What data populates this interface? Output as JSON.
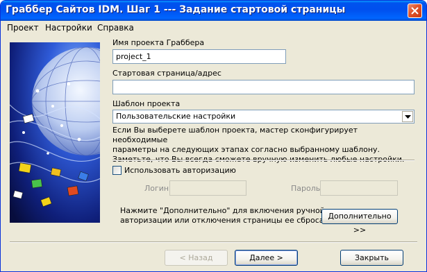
{
  "window": {
    "title": "Граббер Сайтов IDM. Шаг 1 --- Задание стартовой страницы"
  },
  "menu": {
    "items": [
      "Проект",
      "Настройки",
      "Справка"
    ]
  },
  "form": {
    "project_name_label": "Имя проекта Граббера",
    "project_name_value": "project_1",
    "start_page_label": "Стартовая страница/адрес",
    "start_page_value": "",
    "template_label": "Шаблон проекта",
    "template_value": "Пользовательские настройки",
    "info_lines": [
      "Если Вы выберете шаблон проекта, мастер сконфигурирует необходимые",
      "параметры на следующих этапах согласно выбранному шаблону.",
      "Заметьте, что Вы всегда сможете вручную изменить любые настройки."
    ]
  },
  "auth": {
    "checkbox_label": "Использовать авторизацию",
    "login_label": "Логин",
    "login_value": "",
    "password_label": "Пароль",
    "password_value": ""
  },
  "advanced": {
    "note_lines": [
      "Нажмите \"Дополнительно\" для включения ручной",
      "авторизации или отключения страницы ее сброса"
    ],
    "button_label": "Дополнительно >>"
  },
  "footer": {
    "back_label": "< Назад",
    "next_label": "Далее >",
    "close_label": "Закрыть"
  }
}
